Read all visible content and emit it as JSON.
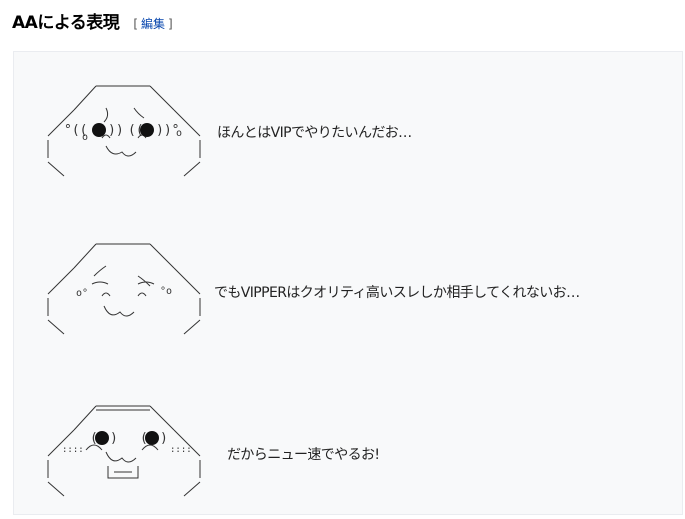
{
  "section": {
    "title": "AAによる表現",
    "edit_open": "[",
    "edit_label": "編集",
    "edit_close": "]"
  },
  "aa_blocks": [
    {
      "caption": "ほんとはVIPでやりたいんだお…"
    },
    {
      "caption": "でもVIPPERはクオリティ高いスレしか相手してくれないお…"
    },
    {
      "caption": "だからニュー速でやるお!"
    }
  ]
}
